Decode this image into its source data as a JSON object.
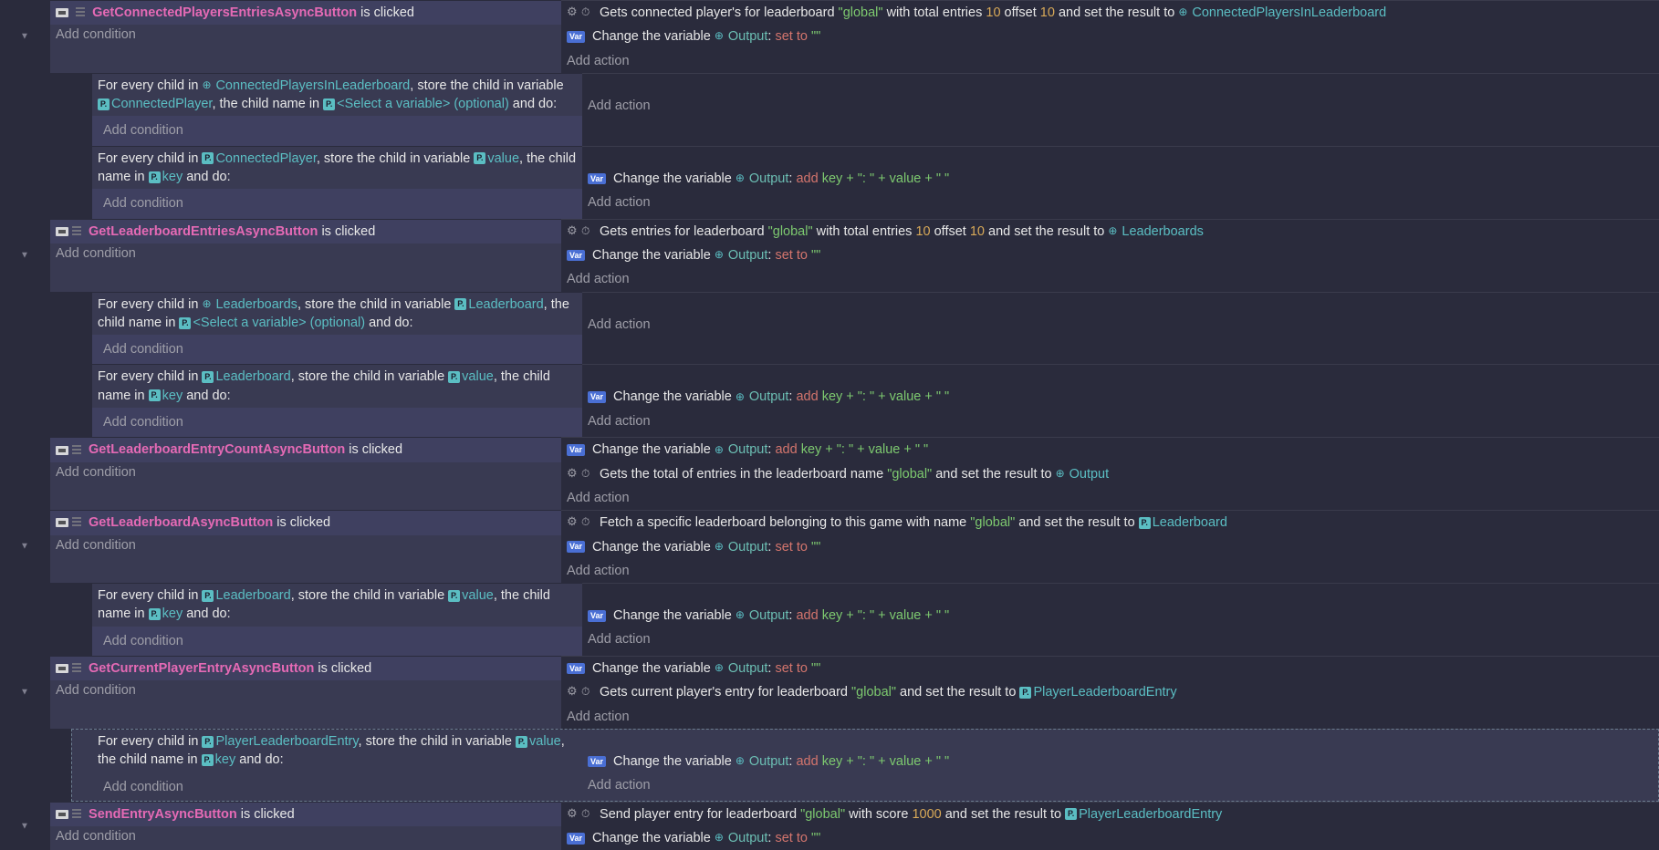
{
  "t": {
    "add_cond": "Add condition",
    "add_act": "Add action",
    "is_clicked": " is clicked",
    "for_every_child": "For every child in ",
    "store_child_var": ", store the child in variable ",
    "child_name_in": ", the child name in ",
    "and_do": " and do:",
    "change_var": "Change the variable ",
    "output": "Output",
    "set_to": "set to",
    "add": "add",
    "empty_q": "\"\"",
    "key_val_expr": " key + \": \" + value + \" \"",
    "var": "Var",
    "sel_var_opt": "<Select a variable> (optional)",
    "global_q": "\"global\"",
    "colon_sp": ": ",
    "v_ConnectedPlayersInLeaderboard": "ConnectedPlayersInLeaderboard",
    "v_ConnectedPlayer": "ConnectedPlayer",
    "v_value": "value",
    "v_key": "key",
    "v_Leaderboards": "Leaderboards",
    "v_Leaderboard": "Leaderboard",
    "v_PlayerLeaderboardEntry": "PlayerLeaderboardEntry",
    "v_Output": "Output"
  },
  "e1": {
    "btn": "GetConnectedPlayersEntriesAsyncButton",
    "a1_pre": "Gets connected player's for leaderboard ",
    "a1_mid1": " with total entries ",
    "n10a": "10",
    "a1_mid2": " offset ",
    "n10b": "10",
    "a1_mid3": " and set the result to "
  },
  "e2": {
    "btn": "GetLeaderboardEntriesAsyncButton",
    "a1_pre": "Gets entries for leaderboard ",
    "a1_mid1": " with total entries ",
    "n10a": "10",
    "a1_mid2": " offset ",
    "n10b": "10",
    "a1_mid3": " and set the result to "
  },
  "e3": {
    "btn": "GetLeaderboardEntryCountAsyncButton",
    "a2_pre": "Gets the total of entries in the leaderboard name ",
    "a2_post": " and set the result to "
  },
  "e4": {
    "btn": "GetLeaderboardAsyncButton",
    "a1_pre": "Fetch a specific leaderboard belonging to this game with name ",
    "a1_post": " and set the result to "
  },
  "e5": {
    "btn": "GetCurrentPlayerEntryAsyncButton",
    "a2_pre": "Gets current player's entry for leaderboard ",
    "a2_post": " and set the result to "
  },
  "e6": {
    "btn": "SendEntryAsyncButton",
    "a1_pre": "Send player entry for leaderboard ",
    "a1_mid1": " with score ",
    "n1000": "1000",
    "a1_post": " and set the result to "
  }
}
